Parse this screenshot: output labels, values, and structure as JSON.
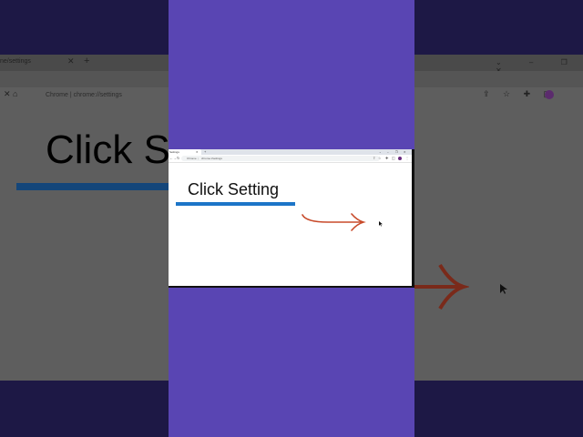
{
  "background": {
    "tab_title": "ne/settings",
    "tab_close": "✕",
    "new_tab": "+",
    "nav_icons": "✕  ⌂",
    "url_text": "Chrome  |  chrome://settings",
    "heading": "Click S",
    "toolbar_icons": "⇪ ☆ ✚ ◫",
    "window_controls": "⌄ – ❐ ✕",
    "colors": {
      "backdrop": "#1d1845",
      "dim": "#5e5e5e",
      "bar": "#14467a",
      "arrow": "#7a2a1a"
    }
  },
  "browser": {
    "tab": {
      "title": "Settings",
      "close": "✕",
      "new": "+"
    },
    "window_controls": {
      "dropdown": "⌄",
      "minimize": "–",
      "maximize": "❐",
      "close": "✕"
    },
    "nav": {
      "back": "←",
      "forward": "→",
      "reload": "↻"
    },
    "omnibox": {
      "site": "Chrome",
      "separator": "|",
      "path": "chrome://settings"
    },
    "toolbar_icons": {
      "share": "⇪",
      "bookmark": "☆",
      "extensions": "✚",
      "sidepanel": "◫",
      "menu": "⋮"
    }
  },
  "content": {
    "heading": "Click Setting",
    "colors": {
      "underline": "#1c75c8",
      "arrow": "#c84a2a",
      "frame": "#5945b3"
    }
  }
}
